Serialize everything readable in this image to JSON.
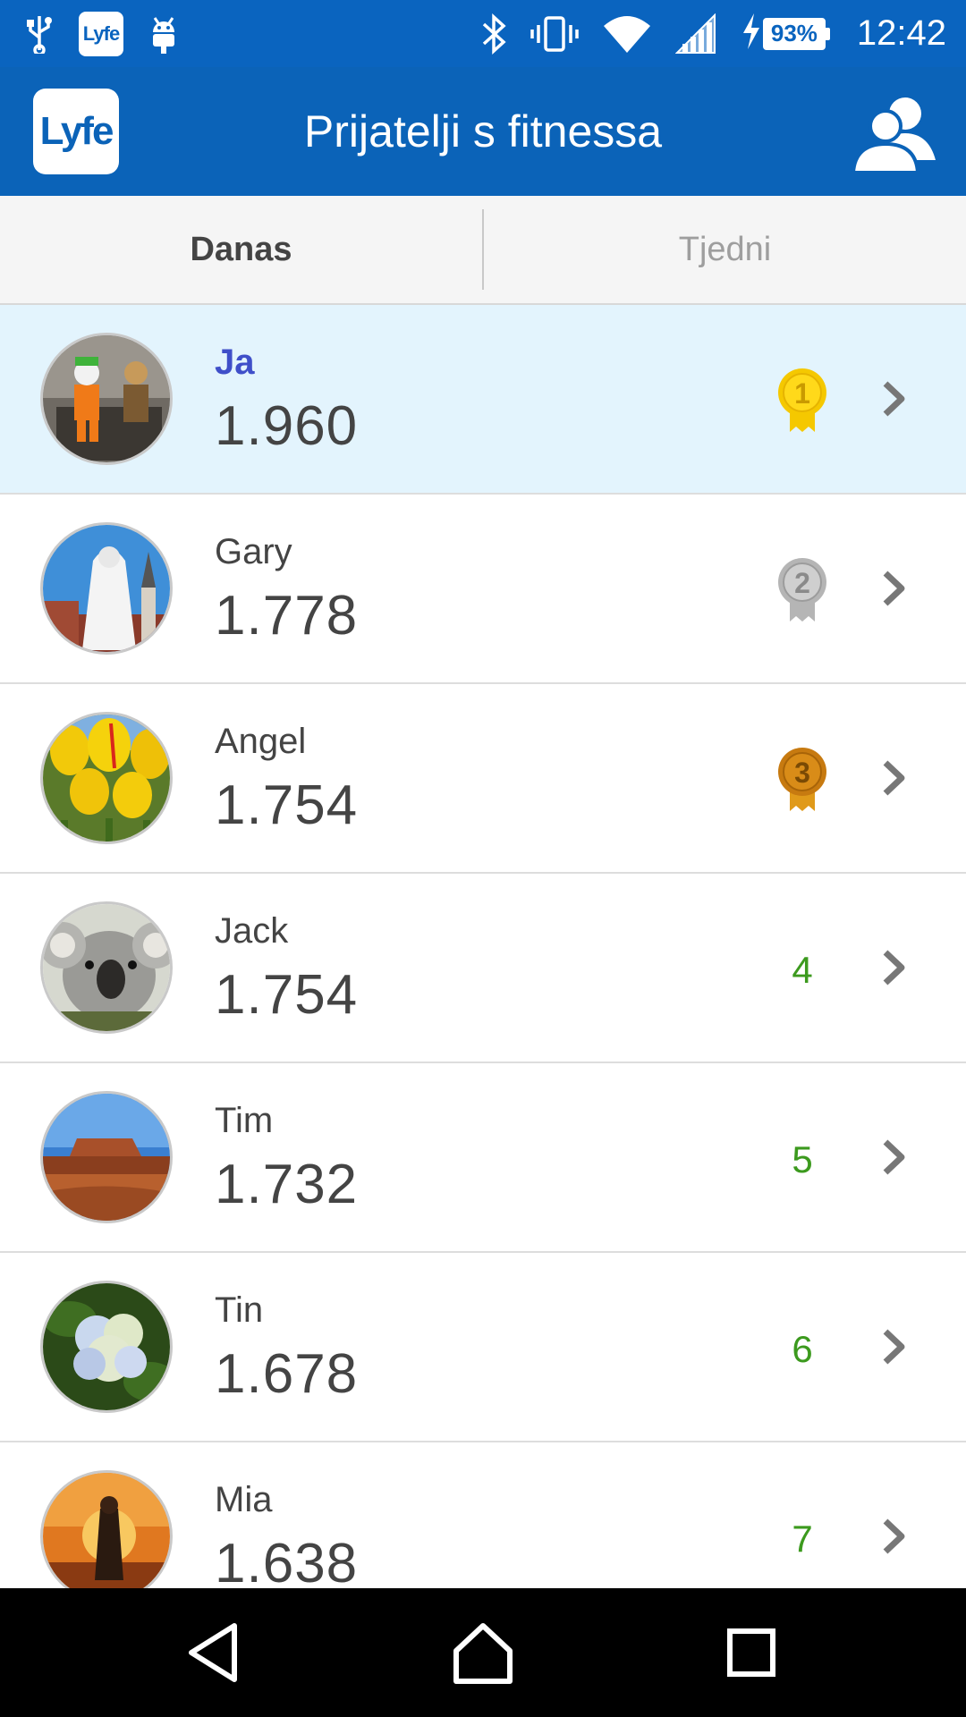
{
  "status_bar": {
    "app_badge": "Lyfe",
    "battery": "93%",
    "time": "12:42"
  },
  "app_bar": {
    "logo": "Lyfe",
    "title": "Prijatelji s fitnessa"
  },
  "tabs": [
    {
      "label": "Danas",
      "active": true
    },
    {
      "label": "Tjedni",
      "active": false
    }
  ],
  "friends": [
    {
      "name": "Ja",
      "score": "1.960",
      "rank": "1",
      "medal": "gold"
    },
    {
      "name": "Gary",
      "score": "1.778",
      "rank": "2",
      "medal": "silver"
    },
    {
      "name": "Angel",
      "score": "1.754",
      "rank": "3",
      "medal": "bronze"
    },
    {
      "name": "Jack",
      "score": "1.754",
      "rank": "4"
    },
    {
      "name": "Tim",
      "score": "1.732",
      "rank": "5"
    },
    {
      "name": "Tin",
      "score": "1.678",
      "rank": "6"
    },
    {
      "name": "Mia",
      "score": "1.638",
      "rank": "7"
    }
  ],
  "colors": {
    "status_bar": "#0a64bf",
    "app_bar": "#0b63b8",
    "highlight_row": "#e3f4fd",
    "self_name": "#3f4fc9",
    "rank_text": "#3c9a1e",
    "gold": "#f5c800",
    "silver": "#b5b5b5",
    "bronze": "#c77a10"
  }
}
